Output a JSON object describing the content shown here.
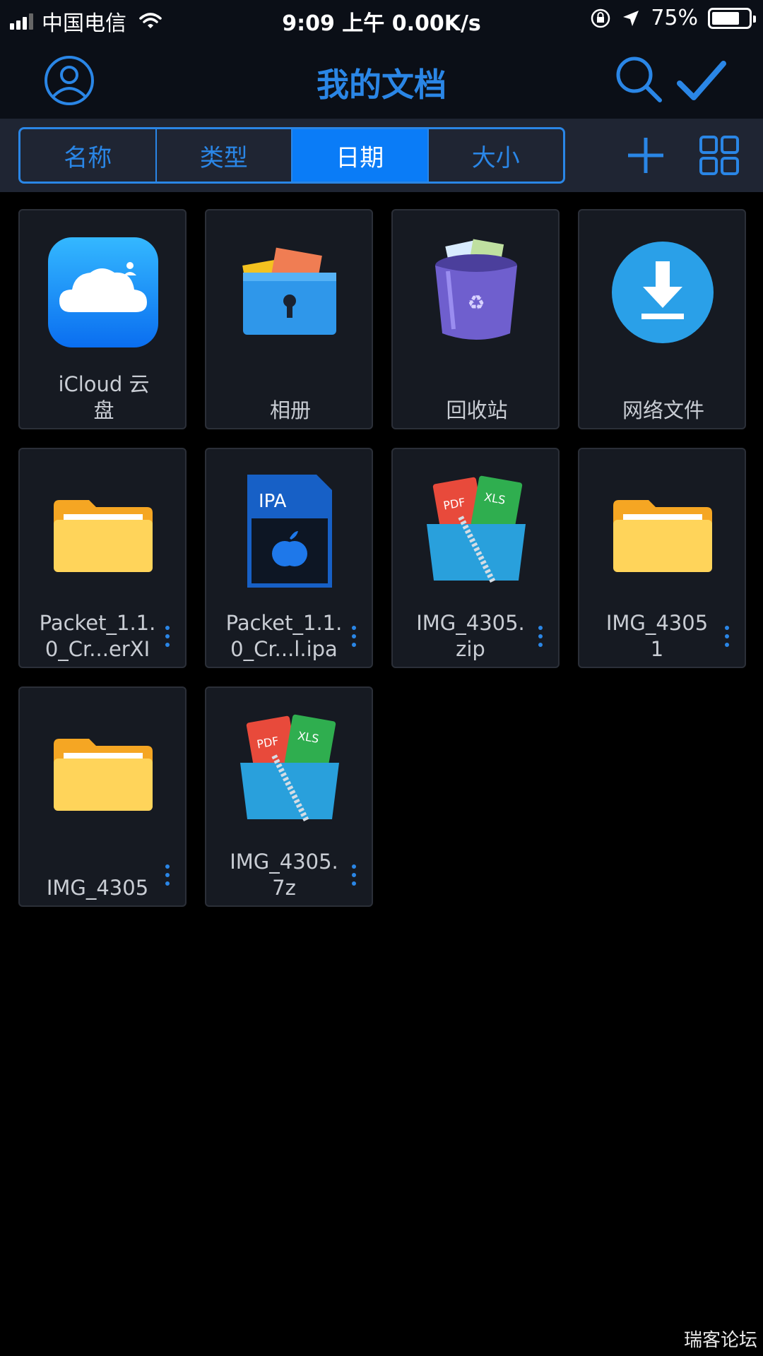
{
  "status_bar": {
    "carrier": "中国电信",
    "time": "9:09 上午 0.00K/s",
    "battery_percent": "75%",
    "battery_level": 0.75
  },
  "nav": {
    "title": "我的文档",
    "left_icon": "profile-icon",
    "right_icons": [
      "search-icon",
      "checkmark-icon"
    ]
  },
  "toolbar": {
    "sort_tabs": [
      {
        "label": "名称",
        "active": false
      },
      {
        "label": "类型",
        "active": false
      },
      {
        "label": "日期",
        "active": true
      },
      {
        "label": "大小",
        "active": false
      }
    ],
    "icons": [
      "plus-icon",
      "grid-view-icon"
    ]
  },
  "files": [
    {
      "label": "iCloud 云\n盘",
      "icon": "icloud-icon",
      "has_menu": false
    },
    {
      "label": "相册",
      "icon": "photo-album-folder-icon",
      "has_menu": false
    },
    {
      "label": "回收站",
      "icon": "recycle-bin-icon",
      "has_menu": false
    },
    {
      "label": "网络文件",
      "icon": "download-icon",
      "has_menu": false
    },
    {
      "label": "Packet_1.1.\n0_Cr...erXI",
      "icon": "folder-icon",
      "has_menu": true
    },
    {
      "label": "Packet_1.1.\n0_Cr...l.ipa",
      "icon": "ipa-file-icon",
      "has_menu": true
    },
    {
      "label": "IMG_4305.\nzip",
      "icon": "archive-icon",
      "has_menu": true
    },
    {
      "label": "IMG_4305\n1",
      "icon": "folder-icon",
      "has_menu": true
    },
    {
      "label": "IMG_4305",
      "icon": "folder-icon",
      "has_menu": true
    },
    {
      "label": "IMG_4305.\n7z",
      "icon": "archive-icon",
      "has_menu": true
    }
  ],
  "icon_text": {
    "ipa": "IPA",
    "pdf": "PDF",
    "xls": "XLS"
  },
  "watermark": "瑞客论坛",
  "colors": {
    "accent": "#2a86e6",
    "active_tab": "#0a7cf7",
    "folder": "#ffd45a",
    "tile_bg": "#161a22"
  }
}
